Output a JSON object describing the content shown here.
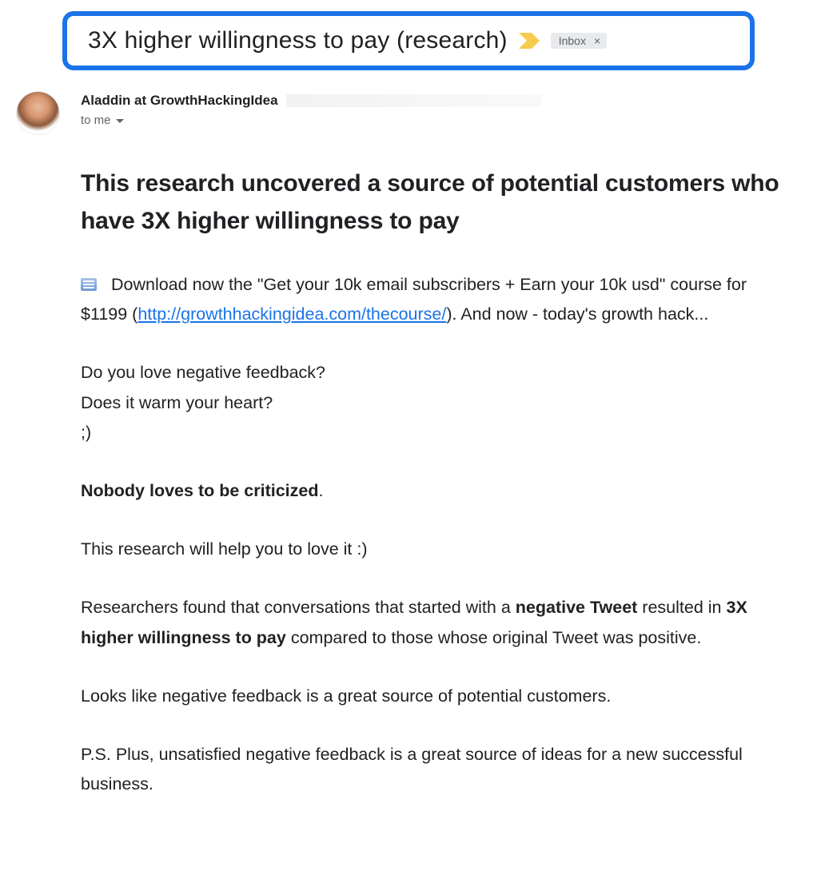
{
  "subject": "3X higher willingness to pay (research)",
  "label": {
    "text": "Inbox",
    "close_glyph": "×"
  },
  "sender": {
    "name": "Aladdin at GrowthHackingIdea"
  },
  "recipient": {
    "to_text": "to me"
  },
  "body": {
    "heading": "This research uncovered a source of potential customers who have 3X higher willingness to pay",
    "intro_before_link": " Download now the \"Get your 10k email subscribers + Earn your 10k usd\" course for $1199 (",
    "link_text": "http://growthhackingidea.com/thecourse/",
    "intro_after_link": "). And now - today's growth hack...",
    "question1": "Do you love negative feedback?",
    "question2": "Does it warm your heart?",
    "wink": ";)",
    "bold_line_text": "Nobody loves to be criticized",
    "bold_line_suffix": ".",
    "love_it": "This research will help you to love it :)",
    "research_p1": "Researchers found that conversations that started with a ",
    "research_b1": "negative Tweet",
    "research_p2": " resulted in ",
    "research_b2": "3X higher willingness to pay",
    "research_p3": " compared to those whose original Tweet was positive.",
    "looks_like": "Looks like negative feedback is a great source of potential customers.",
    "ps": "P.S. Plus, unsatisfied negative feedback is a great source of ideas for a new successful business."
  }
}
